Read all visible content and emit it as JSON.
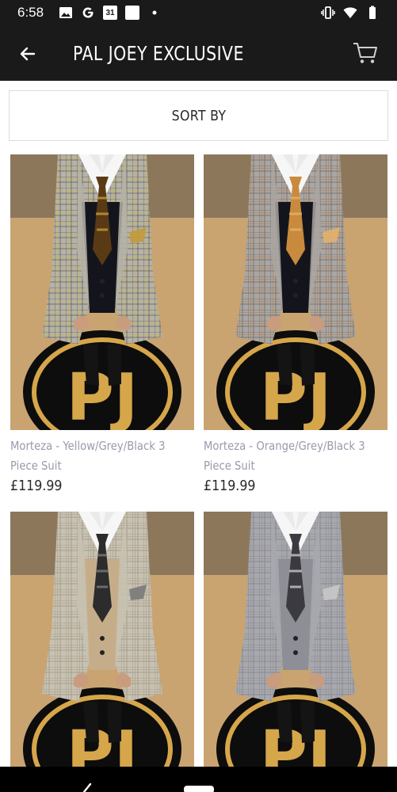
{
  "status_bar": {
    "time": "6:58",
    "left_icons": [
      "image-icon",
      "google-icon",
      "calendar-icon",
      "square-icon",
      "dot-icon"
    ],
    "calendar_day": "31",
    "right_icons": [
      "vibrate-icon",
      "wifi-icon",
      "battery-icon"
    ]
  },
  "app_bar": {
    "title": "PAL JOEY EXCLUSIVE",
    "back_icon": "arrow-left-icon",
    "cart_icon": "cart-icon"
  },
  "sort": {
    "label": "SORT BY"
  },
  "products": [
    {
      "name": "Morteza - Yellow/Grey/Black 3 Piece Suit",
      "price": "£119.99",
      "jacket": "#b5b2a8",
      "check": "#3a3a3a",
      "accent": "#c9b63a",
      "tie": "#5a3a15",
      "tie_pattern": "#c39a3a",
      "waistcoat": "#14151c"
    },
    {
      "name": "Morteza - Orange/Grey/Black 3 Piece Suit",
      "price": "£119.99",
      "jacket": "#aaa6a2",
      "check": "#4a4a4a",
      "accent": "#b57a45",
      "tie": "#c98a3e",
      "tie_pattern": "#e3b26a",
      "waistcoat": "#14151c"
    },
    {
      "name": "",
      "price": "",
      "jacket": "#c8c2b2",
      "check": "#8a8272",
      "accent": "#a89c86",
      "tie": "#2c2c2c",
      "tie_pattern": "#7a7a7a",
      "waistcoat": "#c6ad8a"
    },
    {
      "name": "",
      "price": "",
      "jacket": "#a8a9ae",
      "check": "#6c6d74",
      "accent": "#8f9096",
      "tie": "#3a3a40",
      "tie_pattern": "#c8c8c8",
      "waistcoat": "#8e8f96"
    }
  ],
  "logo": {
    "text": "PJ",
    "gold": "#d6a64a",
    "ring": "#0d0d0d"
  },
  "colors": {
    "app_bar": "#1a1a1a",
    "product_name": "#9a9aae",
    "price": "#2a2a2a",
    "floor": "#c9a471"
  }
}
